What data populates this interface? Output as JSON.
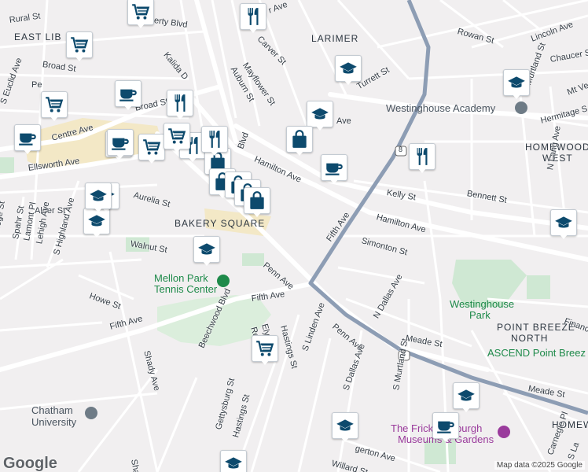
{
  "colors": {
    "background": "#f1eff0",
    "road": "#ffffff",
    "major_road": "#8d9db4",
    "park": "#cfe8d3",
    "pin_icon": "#0d4a6d",
    "shopping_area": "#f3e8c6",
    "building": "#e6e3e4"
  },
  "neighborhoods": {
    "east_liberty": "EAST LIB",
    "larimer": "LARIMER",
    "homewood_west_1": "HOMEWOOD",
    "homewood_west_2": "WEST",
    "bakery_square": "BAKERY SQUARE",
    "point_breeze_north_1": "POINT BREEZE",
    "point_breeze_north_2": "NORTH",
    "homewood_cut": "HOMEW"
  },
  "pois": {
    "westinghouse_academy": "Westinghouse Academy",
    "mellon_park_1": "Mellon Park",
    "mellon_park_2": "Tennis Center",
    "westinghouse_park_1": "Westinghouse",
    "westinghouse_park_2": "Park",
    "ascend": "ASCEND Point Breez",
    "chatham_1": "Chatham",
    "chatham_2": "University",
    "frick_1": "The Frick Pittsburgh",
    "frick_2": "Museums & Gardens"
  },
  "streets": {
    "rural": "Rural St",
    "liberty": "erty Blvd",
    "broad_top": "Broad St",
    "broad_mid": "Broad St",
    "kalida": "Kalida D",
    "carver": "Carver St",
    "mayflower": "Mayflower St",
    "auburn": "Auburn St",
    "ave_top": "r Ave",
    "rowan": "Rowan St",
    "lincoln": "Lincoln Ave",
    "chaucer": "Chaucer St",
    "turrett": "Turrett St",
    "murtland_top": "N Murtland St",
    "mt_vernon": "Mt Ve",
    "hermitage": "Hermitage S",
    "ave_larimer": "Ave",
    "euclid": "S Euclid Ave",
    "centre": "Centre Ave",
    "e_ave": "Pe",
    "blvd": "Blvd",
    "hamilton_1": "Hamilton Ave",
    "hamilton_2": "Hamilton Ave",
    "ellsworth": "Ellsworth Ave",
    "aurelia": "Aurelia St",
    "kelly": "Kelly St",
    "bennett": "Bennett St",
    "lang": "N Lang Ave",
    "alder": "Alder St",
    "spahr": "Spahr St",
    "lamont": "Lamont Pl",
    "lehigh": "Lehigh Ave",
    "highland": "S Highland Ave",
    "college": "College St",
    "walnut": "Walnut St",
    "simonton": "Simonton St",
    "fifth_ne": "Fifth Ave",
    "penn": "Penn Ave",
    "penn_se": "Penn Ave",
    "howe": "Howe St",
    "fifth_w": "Fifth Ave",
    "fifth_mid": "Fifth Ave",
    "shady": "Shady Ave",
    "shady_bottom": "Shady",
    "beechwood": "Beechwood Blvd",
    "elysian": "Elysian St",
    "reynolds": "Rey",
    "hastings_top": "Hastings St",
    "hastings_bottom": "Hastings St",
    "gettysburg": "Gettysburg St",
    "linden": "S Linden Ave",
    "n_dallas": "N Dallas Ave",
    "s_dallas": "S Dallas Ave",
    "s_murtland": "S Murtland St",
    "meade_1": "Meade St",
    "meade_2": "Meade St",
    "finance": "Financ",
    "willard": "Willard St",
    "edgerton": "gerton Ave",
    "carnegie": "Carnegie Pl",
    "s_la": "S La",
    "route_8_a": "8",
    "route_8_b": "8"
  },
  "attribution": {
    "logo": "Google",
    "data": "Map data ©2025 Google"
  },
  "pins": [
    {
      "icon": "cart"
    },
    {
      "icon": "dining"
    },
    {
      "icon": "cart"
    },
    {
      "icon": "school"
    },
    {
      "icon": "cart"
    },
    {
      "icon": "cafe"
    },
    {
      "icon": "dining"
    },
    {
      "icon": "school"
    },
    {
      "icon": "school"
    },
    {
      "icon": "cafe"
    },
    {
      "icon": "dining"
    },
    {
      "icon": "cafe"
    },
    {
      "icon": "cart"
    },
    {
      "icon": "cart"
    },
    {
      "icon": "dining"
    },
    {
      "icon": "cart"
    },
    {
      "icon": "bag"
    },
    {
      "icon": "bag"
    },
    {
      "icon": "bag"
    },
    {
      "icon": "bag"
    },
    {
      "icon": "bag"
    },
    {
      "icon": "bag"
    },
    {
      "icon": "cafe"
    },
    {
      "icon": "dining"
    },
    {
      "icon": "school"
    },
    {
      "icon": "school"
    },
    {
      "icon": "school"
    },
    {
      "icon": "school"
    },
    {
      "icon": "school"
    },
    {
      "icon": "cart"
    },
    {
      "icon": "school"
    },
    {
      "icon": "school"
    },
    {
      "icon": "cafe"
    },
    {
      "icon": "school"
    }
  ]
}
